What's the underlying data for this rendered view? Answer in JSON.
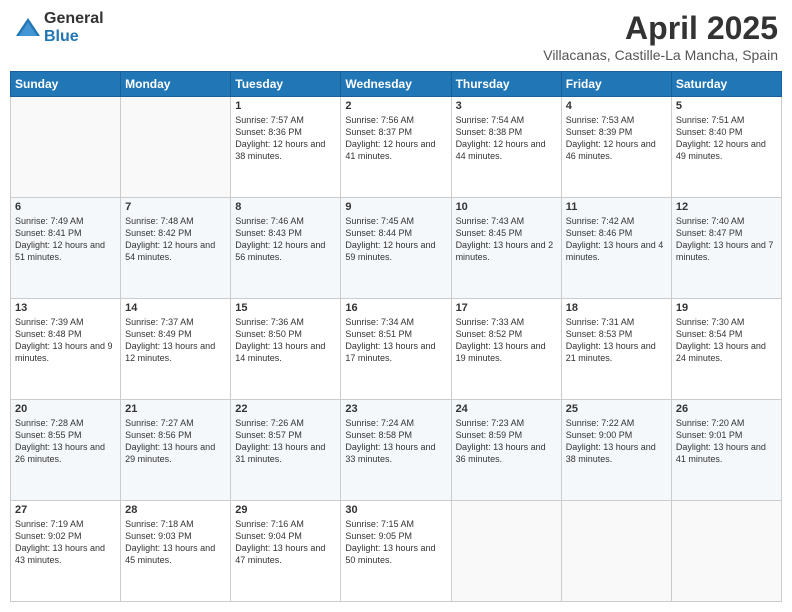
{
  "logo": {
    "general": "General",
    "blue": "Blue"
  },
  "title": {
    "month": "April 2025",
    "location": "Villacanas, Castille-La Mancha, Spain"
  },
  "headers": [
    "Sunday",
    "Monday",
    "Tuesday",
    "Wednesday",
    "Thursday",
    "Friday",
    "Saturday"
  ],
  "weeks": [
    [
      {
        "day": "",
        "sunrise": "",
        "sunset": "",
        "daylight": ""
      },
      {
        "day": "",
        "sunrise": "",
        "sunset": "",
        "daylight": ""
      },
      {
        "day": "1",
        "sunrise": "Sunrise: 7:57 AM",
        "sunset": "Sunset: 8:36 PM",
        "daylight": "Daylight: 12 hours and 38 minutes."
      },
      {
        "day": "2",
        "sunrise": "Sunrise: 7:56 AM",
        "sunset": "Sunset: 8:37 PM",
        "daylight": "Daylight: 12 hours and 41 minutes."
      },
      {
        "day": "3",
        "sunrise": "Sunrise: 7:54 AM",
        "sunset": "Sunset: 8:38 PM",
        "daylight": "Daylight: 12 hours and 44 minutes."
      },
      {
        "day": "4",
        "sunrise": "Sunrise: 7:53 AM",
        "sunset": "Sunset: 8:39 PM",
        "daylight": "Daylight: 12 hours and 46 minutes."
      },
      {
        "day": "5",
        "sunrise": "Sunrise: 7:51 AM",
        "sunset": "Sunset: 8:40 PM",
        "daylight": "Daylight: 12 hours and 49 minutes."
      }
    ],
    [
      {
        "day": "6",
        "sunrise": "Sunrise: 7:49 AM",
        "sunset": "Sunset: 8:41 PM",
        "daylight": "Daylight: 12 hours and 51 minutes."
      },
      {
        "day": "7",
        "sunrise": "Sunrise: 7:48 AM",
        "sunset": "Sunset: 8:42 PM",
        "daylight": "Daylight: 12 hours and 54 minutes."
      },
      {
        "day": "8",
        "sunrise": "Sunrise: 7:46 AM",
        "sunset": "Sunset: 8:43 PM",
        "daylight": "Daylight: 12 hours and 56 minutes."
      },
      {
        "day": "9",
        "sunrise": "Sunrise: 7:45 AM",
        "sunset": "Sunset: 8:44 PM",
        "daylight": "Daylight: 12 hours and 59 minutes."
      },
      {
        "day": "10",
        "sunrise": "Sunrise: 7:43 AM",
        "sunset": "Sunset: 8:45 PM",
        "daylight": "Daylight: 13 hours and 2 minutes."
      },
      {
        "day": "11",
        "sunrise": "Sunrise: 7:42 AM",
        "sunset": "Sunset: 8:46 PM",
        "daylight": "Daylight: 13 hours and 4 minutes."
      },
      {
        "day": "12",
        "sunrise": "Sunrise: 7:40 AM",
        "sunset": "Sunset: 8:47 PM",
        "daylight": "Daylight: 13 hours and 7 minutes."
      }
    ],
    [
      {
        "day": "13",
        "sunrise": "Sunrise: 7:39 AM",
        "sunset": "Sunset: 8:48 PM",
        "daylight": "Daylight: 13 hours and 9 minutes."
      },
      {
        "day": "14",
        "sunrise": "Sunrise: 7:37 AM",
        "sunset": "Sunset: 8:49 PM",
        "daylight": "Daylight: 13 hours and 12 minutes."
      },
      {
        "day": "15",
        "sunrise": "Sunrise: 7:36 AM",
        "sunset": "Sunset: 8:50 PM",
        "daylight": "Daylight: 13 hours and 14 minutes."
      },
      {
        "day": "16",
        "sunrise": "Sunrise: 7:34 AM",
        "sunset": "Sunset: 8:51 PM",
        "daylight": "Daylight: 13 hours and 17 minutes."
      },
      {
        "day": "17",
        "sunrise": "Sunrise: 7:33 AM",
        "sunset": "Sunset: 8:52 PM",
        "daylight": "Daylight: 13 hours and 19 minutes."
      },
      {
        "day": "18",
        "sunrise": "Sunrise: 7:31 AM",
        "sunset": "Sunset: 8:53 PM",
        "daylight": "Daylight: 13 hours and 21 minutes."
      },
      {
        "day": "19",
        "sunrise": "Sunrise: 7:30 AM",
        "sunset": "Sunset: 8:54 PM",
        "daylight": "Daylight: 13 hours and 24 minutes."
      }
    ],
    [
      {
        "day": "20",
        "sunrise": "Sunrise: 7:28 AM",
        "sunset": "Sunset: 8:55 PM",
        "daylight": "Daylight: 13 hours and 26 minutes."
      },
      {
        "day": "21",
        "sunrise": "Sunrise: 7:27 AM",
        "sunset": "Sunset: 8:56 PM",
        "daylight": "Daylight: 13 hours and 29 minutes."
      },
      {
        "day": "22",
        "sunrise": "Sunrise: 7:26 AM",
        "sunset": "Sunset: 8:57 PM",
        "daylight": "Daylight: 13 hours and 31 minutes."
      },
      {
        "day": "23",
        "sunrise": "Sunrise: 7:24 AM",
        "sunset": "Sunset: 8:58 PM",
        "daylight": "Daylight: 13 hours and 33 minutes."
      },
      {
        "day": "24",
        "sunrise": "Sunrise: 7:23 AM",
        "sunset": "Sunset: 8:59 PM",
        "daylight": "Daylight: 13 hours and 36 minutes."
      },
      {
        "day": "25",
        "sunrise": "Sunrise: 7:22 AM",
        "sunset": "Sunset: 9:00 PM",
        "daylight": "Daylight: 13 hours and 38 minutes."
      },
      {
        "day": "26",
        "sunrise": "Sunrise: 7:20 AM",
        "sunset": "Sunset: 9:01 PM",
        "daylight": "Daylight: 13 hours and 41 minutes."
      }
    ],
    [
      {
        "day": "27",
        "sunrise": "Sunrise: 7:19 AM",
        "sunset": "Sunset: 9:02 PM",
        "daylight": "Daylight: 13 hours and 43 minutes."
      },
      {
        "day": "28",
        "sunrise": "Sunrise: 7:18 AM",
        "sunset": "Sunset: 9:03 PM",
        "daylight": "Daylight: 13 hours and 45 minutes."
      },
      {
        "day": "29",
        "sunrise": "Sunrise: 7:16 AM",
        "sunset": "Sunset: 9:04 PM",
        "daylight": "Daylight: 13 hours and 47 minutes."
      },
      {
        "day": "30",
        "sunrise": "Sunrise: 7:15 AM",
        "sunset": "Sunset: 9:05 PM",
        "daylight": "Daylight: 13 hours and 50 minutes."
      },
      {
        "day": "",
        "sunrise": "",
        "sunset": "",
        "daylight": ""
      },
      {
        "day": "",
        "sunrise": "",
        "sunset": "",
        "daylight": ""
      },
      {
        "day": "",
        "sunrise": "",
        "sunset": "",
        "daylight": ""
      }
    ]
  ]
}
